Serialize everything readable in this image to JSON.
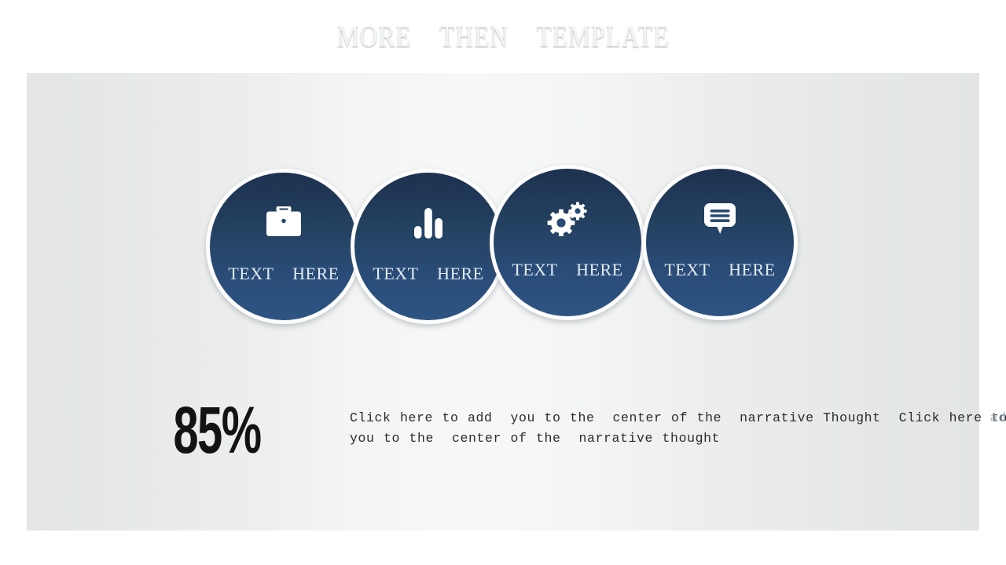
{
  "slide": {
    "title": "MORE    THEN    TEMPLATE",
    "background_color_top": "#16273f",
    "background_color_mid": "#2b5080",
    "background_color_bottom": "#152339",
    "panel_color": "#f7f8f8"
  },
  "circles": [
    {
      "icon": "briefcase-icon",
      "label": "TEXT    HERE",
      "fill_top": "#1d3150",
      "fill_bottom": "#2d5484"
    },
    {
      "icon": "bar-chart-icon",
      "label": "TEXT    HERE",
      "fill_top": "#1d3150",
      "fill_bottom": "#2d5484"
    },
    {
      "icon": "gears-icon",
      "label": "TEXT    HERE",
      "fill_top": "#1d3150",
      "fill_bottom": "#2d5484"
    },
    {
      "icon": "comment-bubble-icon",
      "label": "TEXT    HERE",
      "fill_top": "#1d3150",
      "fill_bottom": "#2d5484"
    }
  ],
  "stat": {
    "value": "85%"
  },
  "body": {
    "text": "Click here to add  you to the  center of the  narrative Thought  Click here to add\nyou to the  center of the  narrative thought"
  }
}
